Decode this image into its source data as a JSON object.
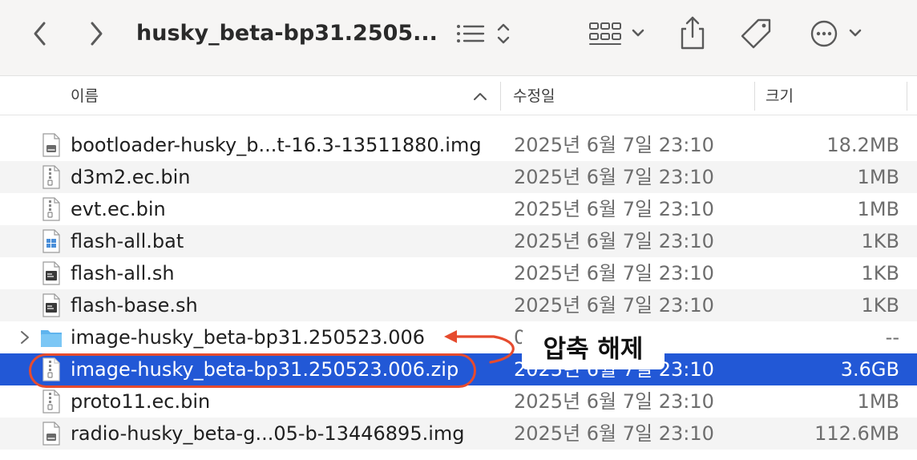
{
  "toolbar": {
    "title": "husky_beta-bp31.2505...",
    "icons": [
      "chevron-left-icon",
      "chevron-right-icon",
      "list-view-icon",
      "updown-chevron-icon",
      "grid-group-icon",
      "chevron-down-icon",
      "share-icon",
      "tag-icon",
      "more-icon"
    ]
  },
  "columns": {
    "name": "이름",
    "date": "수정일",
    "size": "크기"
  },
  "files": [
    {
      "name": "bootloader-husky_b...t-16.3-13511880.img",
      "date": "2025년 6월 7일 23:10",
      "size": "18.2MB",
      "icon": "disk-image-icon"
    },
    {
      "name": "d3m2.ec.bin",
      "date": "2025년 6월 7일 23:10",
      "size": "1MB",
      "icon": "archive-file-icon"
    },
    {
      "name": "evt.ec.bin",
      "date": "2025년 6월 7일 23:10",
      "size": "1MB",
      "icon": "archive-file-icon"
    },
    {
      "name": "flash-all.bat",
      "date": "2025년 6월 7일 23:10",
      "size": "1KB",
      "icon": "windows-file-icon"
    },
    {
      "name": "flash-all.sh",
      "date": "2025년 6월 7일 23:10",
      "size": "1KB",
      "icon": "script-file-icon"
    },
    {
      "name": "flash-base.sh",
      "date": "2025년 6월 7일 23:10",
      "size": "1KB",
      "icon": "script-file-icon"
    },
    {
      "name": "image-husky_beta-bp31.250523.006",
      "date": "0",
      "size": "--",
      "icon": "folder-icon"
    },
    {
      "name": "image-husky_beta-bp31.250523.006.zip",
      "date": "2025년 6월 7일 23:10",
      "size": "3.6GB",
      "icon": "zip-file-icon"
    },
    {
      "name": "proto11.ec.bin",
      "date": "2025년 6월 7일 23:10",
      "size": "1MB",
      "icon": "archive-file-icon"
    },
    {
      "name": "radio-husky_beta-g...05-b-13446895.img",
      "date": "2025년 6월 7일 23:10",
      "size": "112.6MB",
      "icon": "disk-image-icon"
    }
  ],
  "annotation": {
    "label": "압축 해제",
    "color": "#e64b2e"
  },
  "colors": {
    "selection": "#2258d6",
    "toolbar_bg": "#f6f5f4",
    "alt_row": "#f4f4f4"
  }
}
